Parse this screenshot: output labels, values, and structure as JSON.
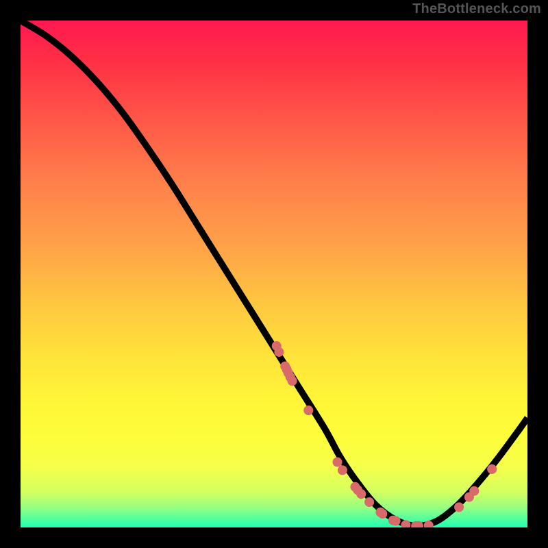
{
  "watermark": "TheBottleneck.com",
  "chart_data": {
    "type": "line",
    "xlabel": "",
    "ylabel": "",
    "xlim": [
      0,
      100
    ],
    "ylim": [
      0,
      100
    ],
    "series": [
      {
        "name": "curve",
        "x": [
          0,
          5,
          10,
          15,
          20,
          25,
          30,
          35,
          40,
          45,
          50,
          55,
          60,
          63,
          66,
          70,
          74,
          78,
          82,
          86,
          90,
          94,
          98,
          100
        ],
        "y": [
          100,
          97,
          93,
          88,
          82,
          75,
          67.5,
          59.5,
          51.5,
          43.5,
          35.5,
          27.5,
          19.5,
          14,
          9.5,
          4.5,
          1.5,
          0.3,
          1.2,
          4.2,
          8.5,
          13.4,
          18.8,
          21.6
        ]
      }
    ],
    "points": {
      "name": "markers",
      "color": "#d86a6a",
      "xy": [
        [
          50.5,
          35.8
        ],
        [
          51.0,
          34.6
        ],
        [
          52.2,
          31.8
        ],
        [
          52.5,
          31.2
        ],
        [
          52.8,
          30.5
        ],
        [
          53.2,
          29.7
        ],
        [
          53.6,
          28.9
        ],
        [
          56.8,
          23.1
        ],
        [
          62.5,
          12.9
        ],
        [
          63.5,
          11.3
        ],
        [
          66.0,
          8.0
        ],
        [
          66.5,
          7.4
        ],
        [
          67.2,
          6.6
        ],
        [
          68.8,
          5.0
        ],
        [
          71.0,
          3.0
        ],
        [
          71.4,
          2.7
        ],
        [
          73.5,
          1.4
        ],
        [
          74.0,
          1.3
        ],
        [
          76.0,
          0.5
        ],
        [
          78.0,
          0.3
        ],
        [
          78.5,
          0.3
        ],
        [
          80.5,
          0.4
        ],
        [
          86.5,
          4.0
        ],
        [
          88.5,
          6.0
        ],
        [
          89.5,
          7.2
        ],
        [
          93.0,
          11.5
        ]
      ]
    }
  }
}
